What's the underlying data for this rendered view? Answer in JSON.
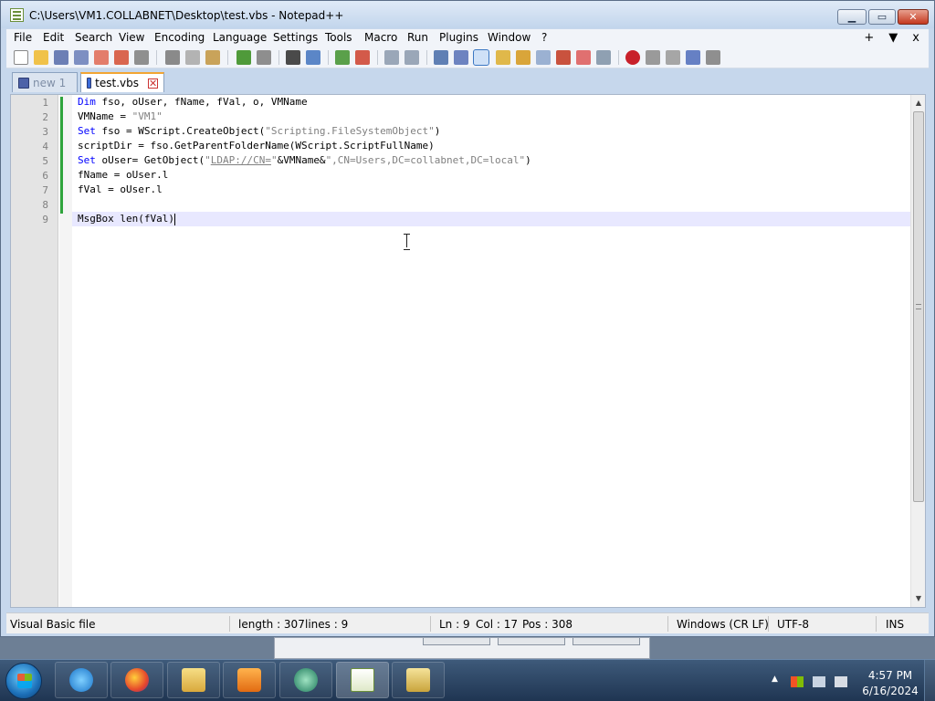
{
  "window": {
    "title": "C:\\Users\\VM1.COLLABNET\\Desktop\\test.vbs - Notepad++"
  },
  "menu": {
    "items": [
      "File",
      "Edit",
      "Search",
      "View",
      "Encoding",
      "Language",
      "Settings",
      "Tools",
      "Macro",
      "Run",
      "Plugins",
      "Window",
      "?"
    ],
    "right_plus": "+",
    "right_down": "▼",
    "right_close": "x"
  },
  "tabs": [
    {
      "label": "new 1",
      "active": false
    },
    {
      "label": "test.vbs",
      "active": true
    }
  ],
  "editor": {
    "line_numbers": [
      "1",
      "2",
      "3",
      "4",
      "5",
      "6",
      "7",
      "8",
      "9"
    ],
    "lines": [
      {
        "segments": [
          {
            "t": "Dim",
            "c": "kw"
          },
          {
            "t": " fso, oUser, fName, fVal, o, VMName",
            "c": ""
          }
        ]
      },
      {
        "segments": [
          {
            "t": "VMName = ",
            "c": ""
          },
          {
            "t": "\"VM1\"",
            "c": "str"
          }
        ]
      },
      {
        "segments": [
          {
            "t": "Set",
            "c": "kw"
          },
          {
            "t": " fso = WScript.CreateObject(",
            "c": ""
          },
          {
            "t": "\"Scripting.FileSystemObject\"",
            "c": "str"
          },
          {
            "t": ")",
            "c": ""
          }
        ]
      },
      {
        "segments": [
          {
            "t": "scriptDir = fso.GetParentFolderName(WScript.ScriptFullName)",
            "c": ""
          }
        ]
      },
      {
        "segments": [
          {
            "t": "Set",
            "c": "kw"
          },
          {
            "t": " oUser= GetObject(",
            "c": ""
          },
          {
            "t": "\"",
            "c": "str"
          },
          {
            "t": "LDAP://CN=",
            "c": "strlink"
          },
          {
            "t": "\"",
            "c": "str"
          },
          {
            "t": "&VMName&",
            "c": ""
          },
          {
            "t": "\",CN=Users,DC=collabnet,DC=local\"",
            "c": "str"
          },
          {
            "t": ")",
            "c": ""
          }
        ]
      },
      {
        "segments": [
          {
            "t": "fName = oUser.l",
            "c": ""
          }
        ]
      },
      {
        "segments": [
          {
            "t": "fVal = oUser.l",
            "c": ""
          }
        ]
      },
      {
        "segments": []
      },
      {
        "segments": [
          {
            "t": "MsgBox len(fVal)",
            "c": ""
          }
        ]
      }
    ]
  },
  "statusbar": {
    "file_type": "Visual Basic file",
    "length": "length : 307",
    "lines": "lines : 9",
    "ln": "Ln : 9",
    "col": "Col : 17",
    "pos": "Pos : 308",
    "eol": "Windows (CR LF)",
    "encoding": "UTF-8",
    "mode": "INS"
  },
  "taskbar": {
    "apps": [
      "internet-explorer",
      "firefox",
      "file-explorer",
      "media-player",
      "app-globe",
      "notepadplusplus",
      "app-tool"
    ],
    "time": "4:57 PM",
    "date": "6/16/2024"
  },
  "colors": {
    "keyword": "#0000ff",
    "string": "#808080",
    "current_line": "#e8e8ff",
    "change_bar": "#2fa43c",
    "active_tab_accent": "#f2a533"
  }
}
